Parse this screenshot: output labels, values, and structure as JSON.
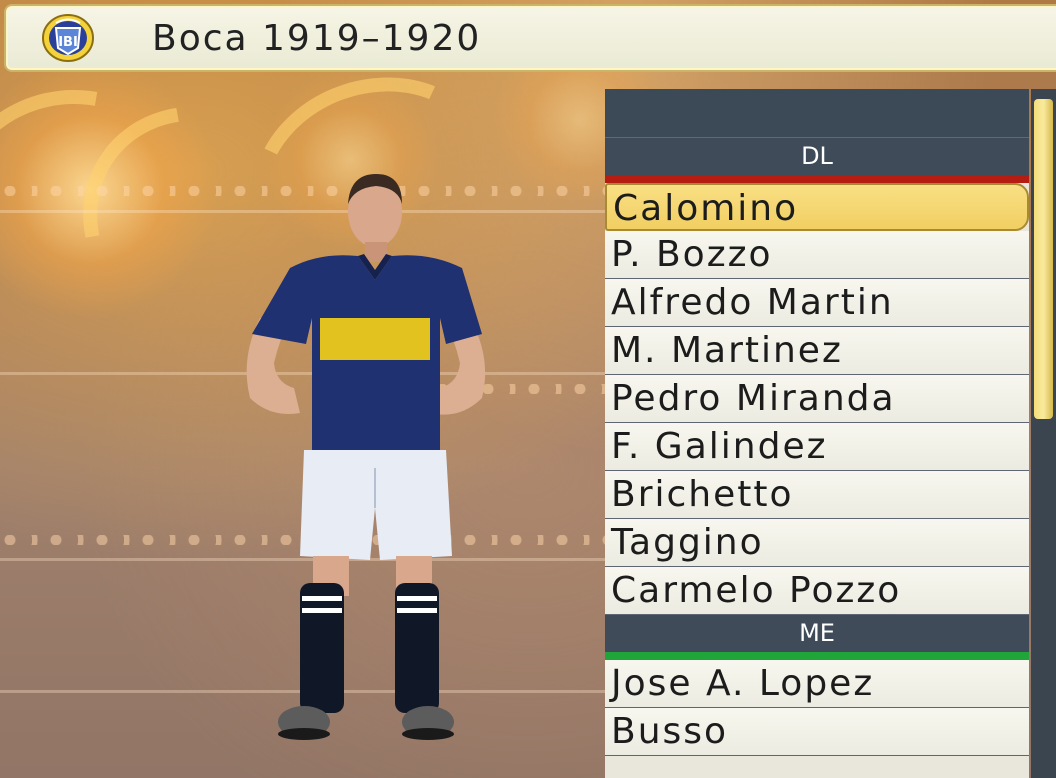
{
  "header": {
    "title": "Boca 1919–1920",
    "crest_icon": "club-crest-icon"
  },
  "squad": {
    "sections": [
      {
        "label": "DL",
        "color": "#b51c12",
        "players": [
          "Calomino",
          "P. Bozzo",
          "Alfredo Martin",
          "M. Martinez",
          "Pedro Miranda",
          "F. Galindez",
          "Brichetto",
          "Taggino",
          "Carmelo Pozzo"
        ]
      },
      {
        "label": "ME",
        "color": "#20a53b",
        "players": [
          "Jose A. Lopez",
          "Busso"
        ]
      }
    ],
    "selected": "Calomino"
  },
  "colors": {
    "selection": "#f5d56c",
    "panel_header": "#3c4957",
    "kit_shirt": "#1f3170",
    "kit_stripe": "#e2c21e"
  }
}
